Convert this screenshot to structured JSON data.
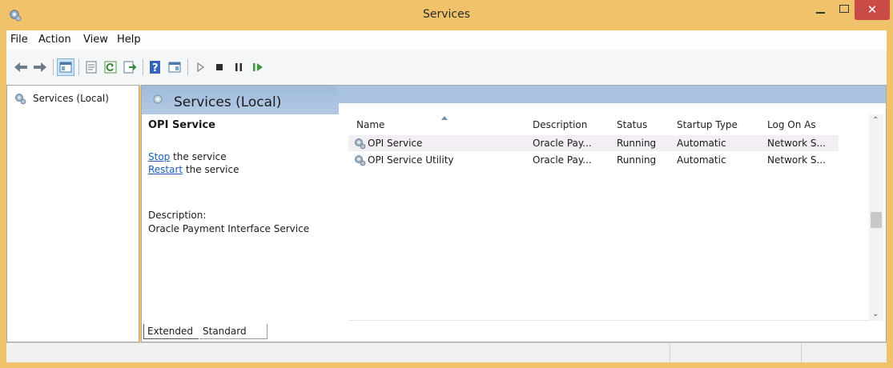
{
  "window": {
    "title": "Services",
    "close_label": "✕"
  },
  "menu": {
    "items": [
      "File",
      "Action",
      "View",
      "Help"
    ]
  },
  "toolbar": {
    "buttons": [
      "back-icon",
      "forward-icon",
      "show-hide-console-tree-icon",
      "properties-icon",
      "refresh-icon",
      "export-list-icon",
      "help-icon",
      "show-hide-action-pane-icon",
      "start-service-icon",
      "stop-service-icon",
      "pause-service-icon",
      "resume-service-icon"
    ]
  },
  "tree": {
    "root_label": "Services (Local)"
  },
  "panel": {
    "header_title": "Services (Local)",
    "selected_service": "OPI Service",
    "stop_link": "Stop",
    "stop_suffix": " the service",
    "restart_link": "Restart",
    "restart_suffix": " the service",
    "description_label": "Description:",
    "description_text": "Oracle Payment Interface Service"
  },
  "table": {
    "columns": [
      "Name",
      "Description",
      "Status",
      "Startup Type",
      "Log On As"
    ],
    "rows": [
      {
        "name": "OPI Service",
        "description": "Oracle Pay...",
        "status": "Running",
        "startup": "Automatic",
        "logon": "Network S...",
        "selected": true
      },
      {
        "name": "OPI Service Utility",
        "description": "Oracle Pay...",
        "status": "Running",
        "startup": "Automatic",
        "logon": "Network S...",
        "selected": false
      }
    ]
  },
  "tabs": {
    "extended": "Extended",
    "standard": "Standard"
  },
  "colors": {
    "frame": "#f0c36a",
    "header_band": "#a9c3e0",
    "close_button": "#c94a46",
    "link": "#1a5fb4"
  }
}
